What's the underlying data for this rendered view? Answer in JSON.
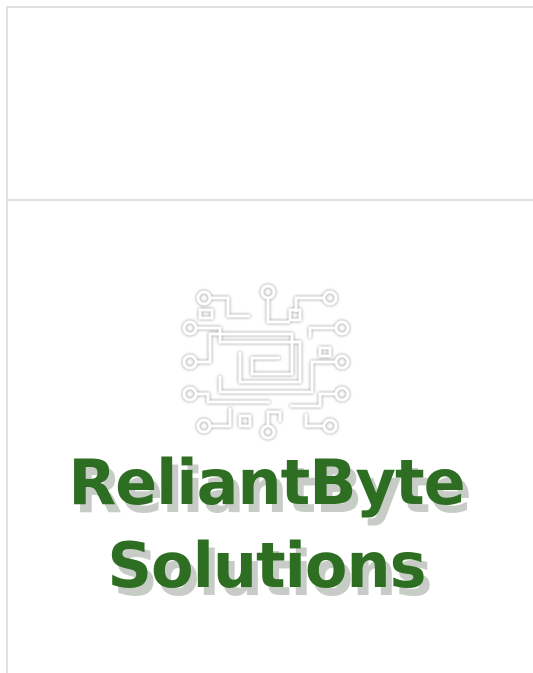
{
  "logo": {
    "icon": "circuit-board-icon",
    "line1": "ReliantByte",
    "line2": "Solutions",
    "text_color": "#2d6e22",
    "shadow_color": "#c8ccc6"
  },
  "layout": {
    "border_color": "#e1e1e1",
    "background": "#ffffff"
  }
}
